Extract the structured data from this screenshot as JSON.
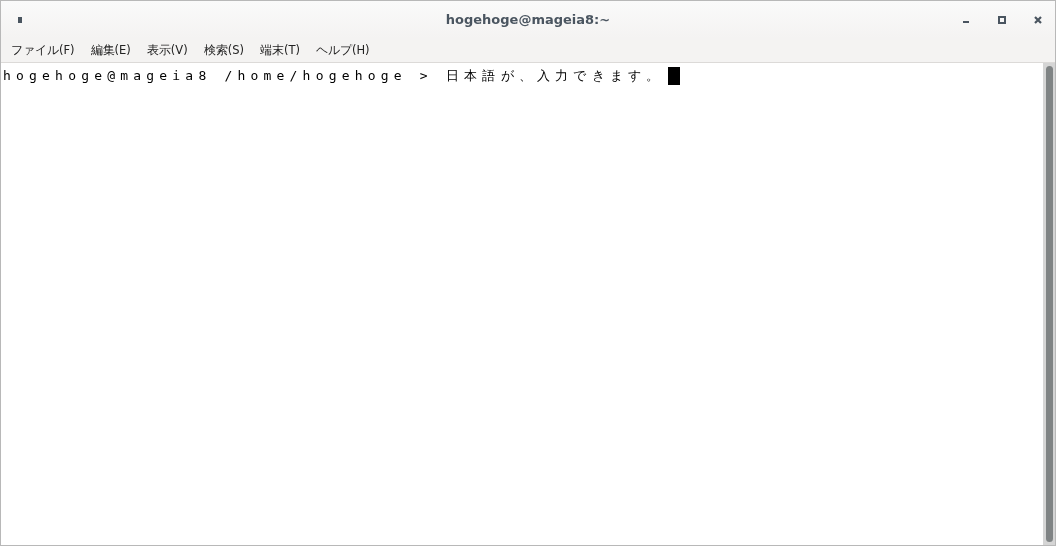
{
  "window": {
    "title": "hogehoge@mageia8:~"
  },
  "menu": [
    "ファイル(F)",
    "編集(E)",
    "表示(V)",
    "検索(S)",
    "端末(T)",
    "ヘルプ(H)"
  ],
  "terminal": {
    "lines": [
      "hogehoge@mageia8 /home/hogehoge > 日本語が、入力できます。"
    ]
  }
}
